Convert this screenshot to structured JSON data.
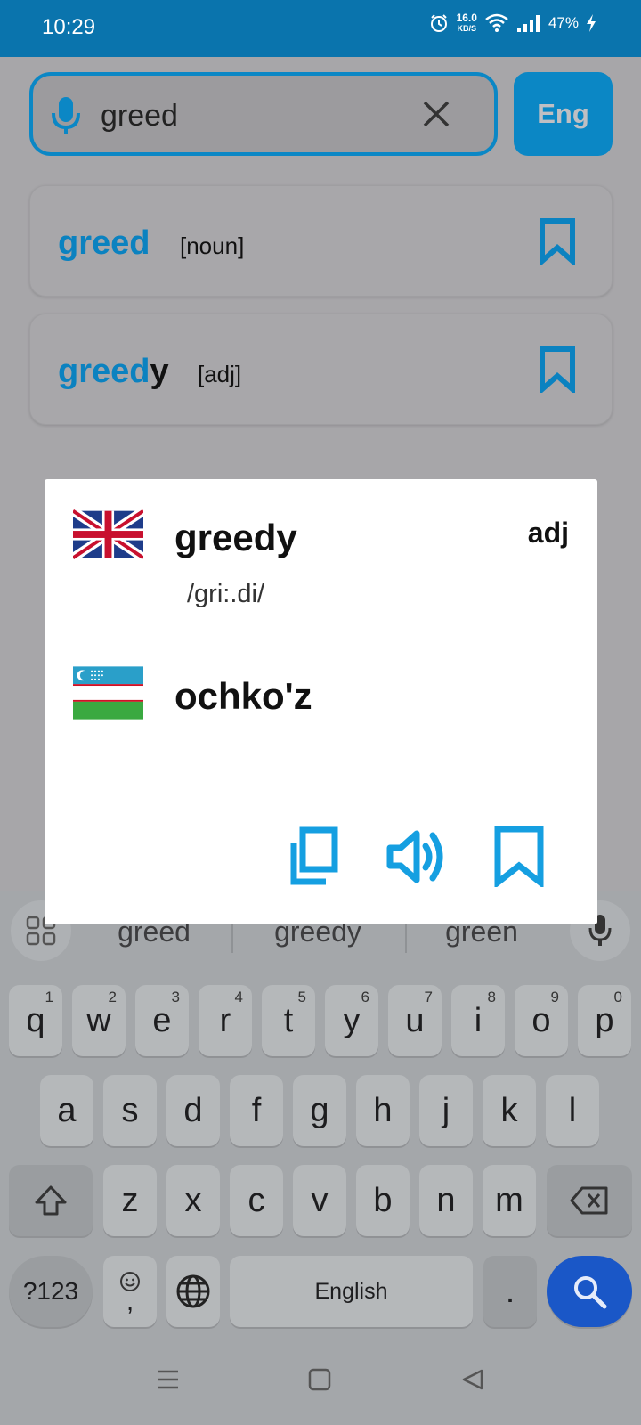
{
  "status_bar": {
    "time": "10:29",
    "net_speed_value": "16.0",
    "net_speed_unit": "KB/S",
    "battery": "47%"
  },
  "search": {
    "query": "greed",
    "language_button": "Eng"
  },
  "results": [
    {
      "match": "greed",
      "rest": "",
      "pos": "[noun]"
    },
    {
      "match": "greed",
      "rest": "y",
      "pos": "[adj]"
    }
  ],
  "popup": {
    "word": "greedy",
    "pos": "adj",
    "pronunciation": "/gri:.di/",
    "translation": "ochko'z",
    "source_flag": "uk-flag-icon",
    "target_flag": "uzbekistan-flag-icon",
    "actions": [
      "copy-icon",
      "speaker-icon",
      "bookmark-icon"
    ]
  },
  "keyboard": {
    "suggestions": [
      "greed",
      "greedy",
      "green"
    ],
    "row1": [
      {
        "k": "q",
        "n": "1"
      },
      {
        "k": "w",
        "n": "2"
      },
      {
        "k": "e",
        "n": "3"
      },
      {
        "k": "r",
        "n": "4"
      },
      {
        "k": "t",
        "n": "5"
      },
      {
        "k": "y",
        "n": "6"
      },
      {
        "k": "u",
        "n": "7"
      },
      {
        "k": "i",
        "n": "8"
      },
      {
        "k": "o",
        "n": "9"
      },
      {
        "k": "p",
        "n": "0"
      }
    ],
    "row2": [
      "a",
      "s",
      "d",
      "f",
      "g",
      "h",
      "j",
      "k",
      "l"
    ],
    "row3": [
      "z",
      "x",
      "c",
      "v",
      "b",
      "n",
      "m"
    ],
    "symbols_key": "?123",
    "comma_key": ",",
    "space_label": "English",
    "period_key": "."
  },
  "colors": {
    "accent": "#0b87c5",
    "status_bar": "#0a74ad",
    "search_key": "#1a57c7"
  }
}
